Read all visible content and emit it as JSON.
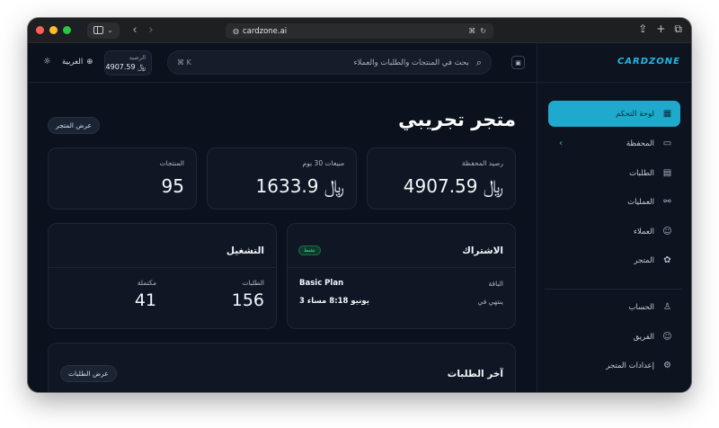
{
  "browser": {
    "url": "cardzone.ai"
  },
  "brand": {
    "logo_text": "CARDZONE",
    "accent": "#1fa9cc"
  },
  "sidebar": {
    "items": [
      {
        "label": "لوحة التحكم",
        "icon": "dashboard-icon",
        "active": true
      },
      {
        "label": "المحفظة",
        "icon": "wallet-icon",
        "active": false
      },
      {
        "label": "الطلبات",
        "icon": "orders-icon",
        "active": false
      },
      {
        "label": "العمليات",
        "icon": "operations-icon",
        "active": false
      },
      {
        "label": "العملاء",
        "icon": "customers-icon",
        "active": false
      },
      {
        "label": "المتجر",
        "icon": "store-icon",
        "active": false
      }
    ],
    "bottom_items": [
      {
        "label": "الحساب",
        "icon": "account-icon"
      },
      {
        "label": "الفريق",
        "icon": "team-icon"
      },
      {
        "label": "إعدادات المتجر",
        "icon": "settings-icon"
      }
    ]
  },
  "topbar": {
    "search_placeholder": "بحث في المنتجات والطلبات والعملاء",
    "shortcut": "⌘ K",
    "balance_label": "الرصيد",
    "balance_value": "4907.59 ﷼",
    "language": "العربية"
  },
  "main": {
    "title": "متجر تجريبي",
    "view_store": "عرض المتجر",
    "stats": [
      {
        "label": "رصيد المحفظة",
        "value": "4907.59 ﷼"
      },
      {
        "label": "مبيعات 30 يوم",
        "value": "1633.9 ﷼"
      },
      {
        "label": "المنتجات",
        "value": "95"
      }
    ],
    "subscription": {
      "title": "الاشتراك",
      "status": "نشط",
      "plan_label": "الباقة",
      "plan_value": "Basic Plan",
      "ends_label": "ينتهي في",
      "ends_value": "3 يونيو 8:18 مساء"
    },
    "operations": {
      "title": "التشغيل",
      "orders_label": "الطلبات",
      "orders_value": "156",
      "completed_label": "مكتملة",
      "completed_value": "41"
    },
    "latest_orders": {
      "title": "آخر الطلبات",
      "view_orders": "عرض الطلبات"
    }
  }
}
